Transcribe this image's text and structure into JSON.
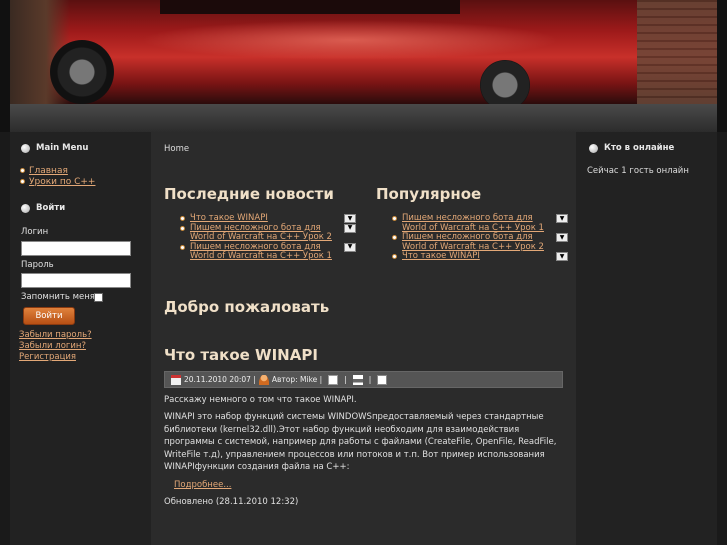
{
  "left": {
    "main_menu_title": "Main Menu",
    "menu": [
      "Главная",
      "Уроки по C++"
    ],
    "login_title": "Войти",
    "login_label": "Логин",
    "password_label": "Пароль",
    "remember_label": "Запомнить меня",
    "submit": "Войти",
    "links": [
      "Забыли пароль?",
      "Забыли логин?",
      "Регистрация"
    ]
  },
  "main": {
    "breadcrumb": "Home",
    "latest_title": "Последние новости",
    "latest": [
      "Что такое WINAPI",
      "Пишем несложного бота для World of Warcraft на C++ Урок 2",
      "Пишем несложного бота для World of Warcraft на C++ Урок 1"
    ],
    "popular_title": "Популярное",
    "popular": [
      "Пишем несложного бота для World of Warcraft на C++ Урок 1",
      "Пишем несложного бота для World of Warcraft на C++ Урок 2",
      "Что такое WINAPI"
    ],
    "welcome": "Добро пожаловать",
    "article_title": "Что такое WINAPI",
    "date": "20.11.2010 20:07 |",
    "author": "Автор: Mike |",
    "sep1": "|",
    "sep2": "|",
    "intro": "Расскажу немного о том что такое WINAPI.",
    "body": "WINAPI   это набор функций системы   WINDOWSпредоставляемый через стандартные библиотеки  (kernel32.dll).Этот набор функций необходим для  взаимодействия программы с системой, например для работы с файлами  (CreateFile,  OpenFile,  ReadFile,  WriteFile т.д), управлением процессов или потоков и т.п. Вот пример использования  WINAPIфункции создания файла на C++:",
    "more": "Подробнее...",
    "updated": "Обновлено (28.11.2010 12:32)"
  },
  "right": {
    "who_title": "Кто в онлайне",
    "who_text": "Сейчас 1 гость онлайн"
  }
}
